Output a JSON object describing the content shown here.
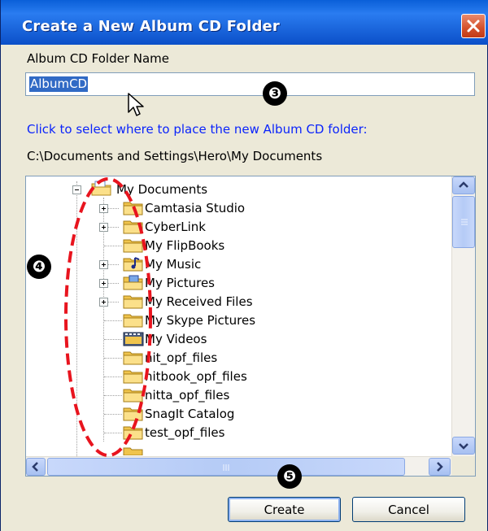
{
  "dialog": {
    "title": "Create a New Album CD Folder",
    "name_label": "Album CD Folder Name",
    "name_value": "AlbumCD",
    "location_prompt": "Click to select where to place the new Album CD folder:",
    "current_path": "C:\\Documents and Settings\\Hero\\My Documents"
  },
  "tree": {
    "root": {
      "label": "My Documents",
      "icon": "documents-folder-icon",
      "expanded": true
    },
    "items": [
      {
        "label": "Camtasia Studio",
        "icon": "folder-icon",
        "expander": "plus"
      },
      {
        "label": "CyberLink",
        "icon": "folder-icon",
        "expander": "plus"
      },
      {
        "label": "My FlipBooks",
        "icon": "folder-icon",
        "expander": "none"
      },
      {
        "label": "My Music",
        "icon": "music-folder-icon",
        "expander": "plus"
      },
      {
        "label": "My Pictures",
        "icon": "pictures-folder-icon",
        "expander": "plus"
      },
      {
        "label": "My Received Files",
        "icon": "folder-icon",
        "expander": "plus"
      },
      {
        "label": "My Skype Pictures",
        "icon": "folder-icon",
        "expander": "none"
      },
      {
        "label": "My Videos",
        "icon": "videos-folder-icon",
        "expander": "none"
      },
      {
        "label": "nit_opf_files",
        "icon": "folder-icon",
        "expander": "none"
      },
      {
        "label": "nitbook_opf_files",
        "icon": "folder-icon",
        "expander": "none"
      },
      {
        "label": "nitta_opf_files",
        "icon": "folder-icon",
        "expander": "none"
      },
      {
        "label": "SnagIt Catalog",
        "icon": "folder-icon",
        "expander": "none"
      },
      {
        "label": "test_opf_files",
        "icon": "folder-icon",
        "expander": "none"
      }
    ]
  },
  "buttons": {
    "create": "Create",
    "cancel": "Cancel"
  },
  "annotations": {
    "step3": "❸",
    "step4": "❹",
    "step5": "❺",
    "highlight_color": "#e8141e"
  },
  "colors": {
    "title_bar": "#0b5ae0",
    "prompt_text": "#0b24fb",
    "selection": "#316ac5",
    "close_button": "#d4502a"
  }
}
